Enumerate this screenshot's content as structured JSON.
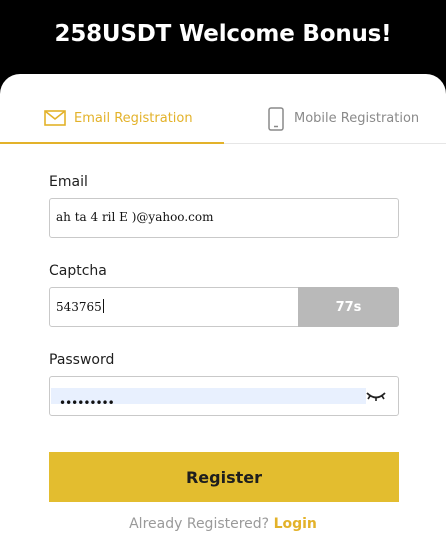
{
  "header": {
    "title": "258USDT Welcome Bonus!"
  },
  "tabs": [
    {
      "label": "Email Registration",
      "icon": "mail-icon",
      "active": true,
      "color": "#e3b22a"
    },
    {
      "label": "Mobile Registration",
      "icon": "smartphone-icon",
      "active": false
    }
  ],
  "form": {
    "email": {
      "label": "Email",
      "value": "ah‌ ta‌  ‌4 ‌ril E‌ ‌)@yahoo.com"
    },
    "captcha": {
      "label": "Captcha",
      "value": "543765",
      "timer": "77s"
    },
    "password": {
      "label": "Password",
      "value": "•••••••••",
      "toggle_icon": "eye-closed-icon"
    }
  },
  "register_button": {
    "label": "Register",
    "color": "#e3bd2f"
  },
  "footer": {
    "question": "Already Registered?",
    "login_link": "Login"
  }
}
